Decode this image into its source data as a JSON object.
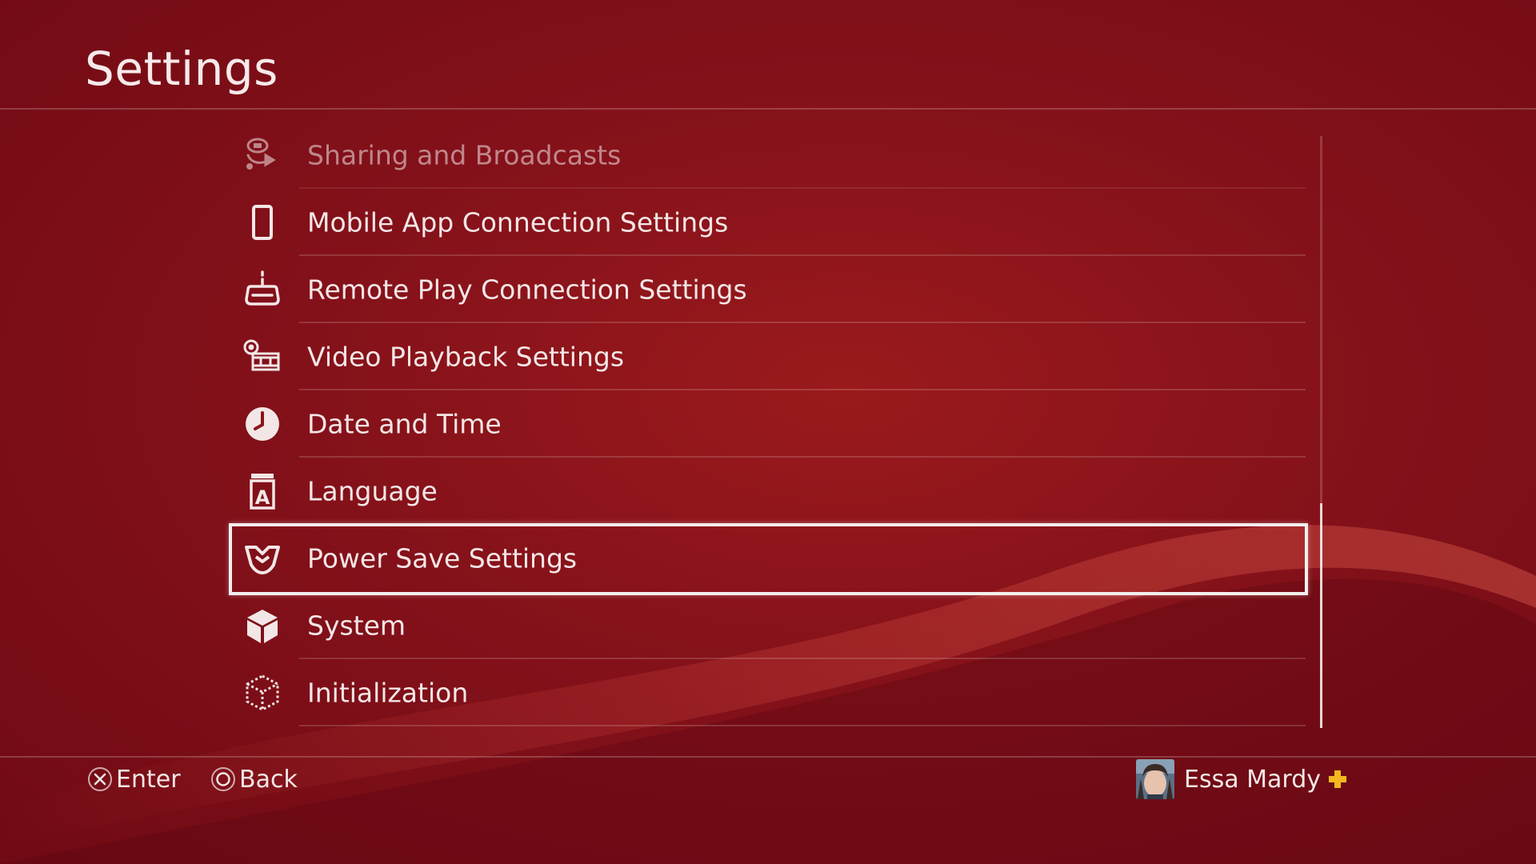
{
  "page": {
    "title": "Settings"
  },
  "theme": {
    "background": "#7f0f17",
    "text": "#f3e6e6",
    "plus_color": "#f2b81e"
  },
  "menu": {
    "items": [
      {
        "label": "Sharing and Broadcasts",
        "icon": "broadcast-icon",
        "state": "faded"
      },
      {
        "label": "Mobile App Connection Settings",
        "icon": "phone-icon",
        "state": "normal"
      },
      {
        "label": "Remote Play Connection Settings",
        "icon": "remote-play-icon",
        "state": "normal"
      },
      {
        "label": "Video Playback Settings",
        "icon": "film-reel-icon",
        "state": "normal"
      },
      {
        "label": "Date and Time",
        "icon": "clock-icon",
        "state": "normal"
      },
      {
        "label": "Language",
        "icon": "language-icon",
        "state": "normal"
      },
      {
        "label": "Power Save Settings",
        "icon": "power-save-icon",
        "state": "selected"
      },
      {
        "label": "System",
        "icon": "cube-icon",
        "state": "normal"
      },
      {
        "label": "Initialization",
        "icon": "dotted-cube-icon",
        "state": "normal"
      }
    ]
  },
  "scroll": {
    "position_fraction": 0.62,
    "visible_fraction": 0.38
  },
  "footer": {
    "enter_label": "Enter",
    "back_label": "Back",
    "enter_icon": "cross-button-icon",
    "back_icon": "circle-button-icon"
  },
  "user": {
    "name": "Essa Mardy",
    "plus_icon": "playstation-plus-icon"
  }
}
